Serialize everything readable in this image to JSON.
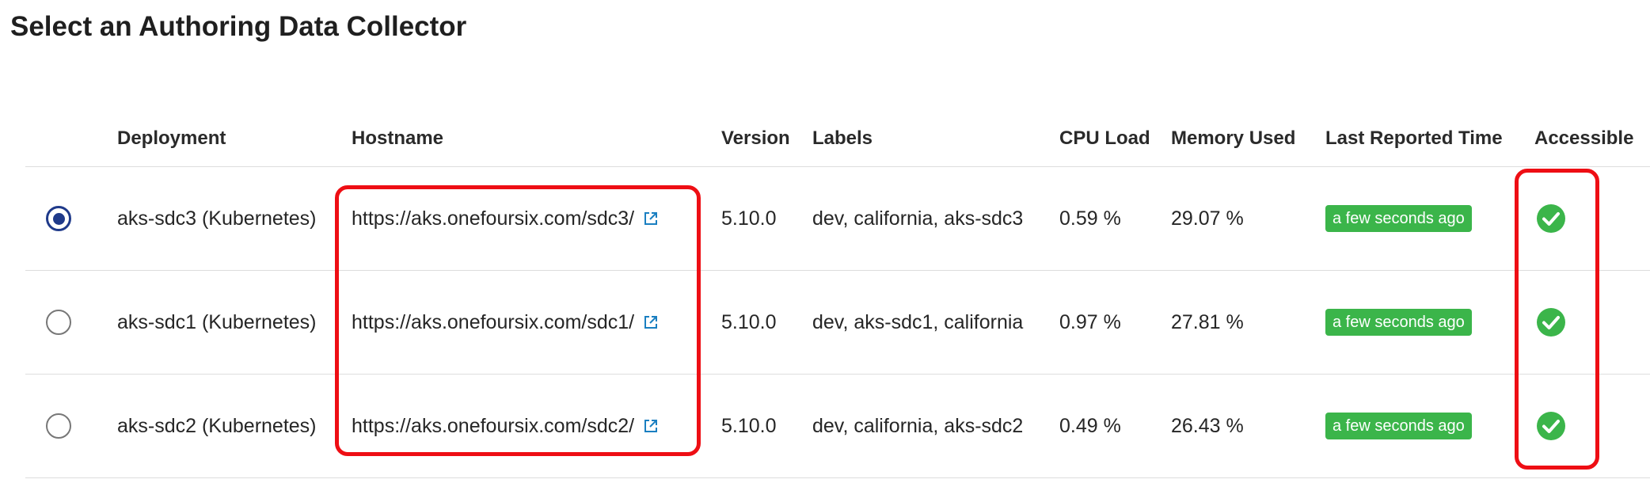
{
  "page": {
    "title": "Select an Authoring Data Collector"
  },
  "table": {
    "columns": {
      "deployment": "Deployment",
      "hostname": "Hostname",
      "version": "Version",
      "labels": "Labels",
      "cpu": "CPU Load",
      "memory": "Memory Used",
      "last_reported": "Last Reported Time",
      "accessible": "Accessible"
    },
    "rows": [
      {
        "selected": true,
        "deployment": "aks-sdc3 (Kubernetes)",
        "hostname": "https://aks.onefoursix.com/sdc3/",
        "version": "5.10.0",
        "labels": "dev, california, aks-sdc3",
        "cpu": "0.59 %",
        "memory": "29.07 %",
        "last_reported": "a few seconds ago",
        "accessible": true
      },
      {
        "selected": false,
        "deployment": "aks-sdc1 (Kubernetes)",
        "hostname": "https://aks.onefoursix.com/sdc1/",
        "version": "5.10.0",
        "labels": "dev, aks-sdc1, california",
        "cpu": "0.97 %",
        "memory": "27.81 %",
        "last_reported": "a few seconds ago",
        "accessible": true
      },
      {
        "selected": false,
        "deployment": "aks-sdc2 (Kubernetes)",
        "hostname": "https://aks.onefoursix.com/sdc2/",
        "version": "5.10.0",
        "labels": "dev, california, aks-sdc2",
        "cpu": "0.49 %",
        "memory": "26.43 %",
        "last_reported": "a few seconds ago",
        "accessible": true
      }
    ]
  },
  "icons": {
    "external_link": "external-link-icon",
    "accessible": "check-circle-icon"
  },
  "colors": {
    "accent": "#1f3a8a",
    "link_icon": "#1a7fc1",
    "success": "#3bb54a",
    "highlight": "#ee0e14",
    "divider": "#dddddd"
  }
}
